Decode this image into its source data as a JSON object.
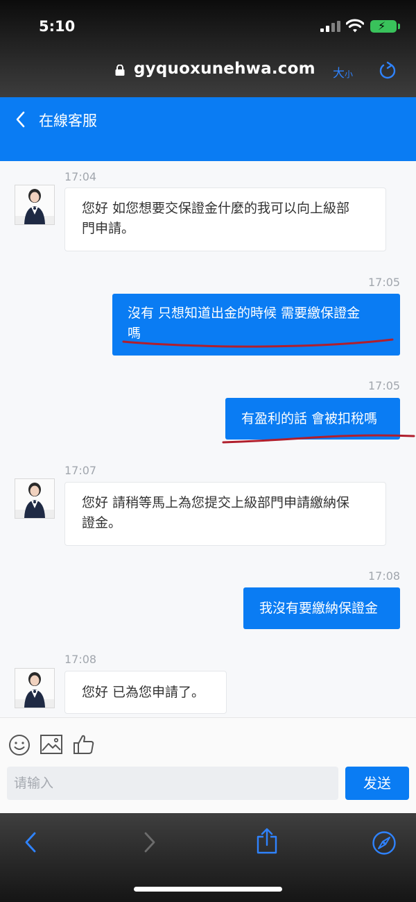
{
  "status_bar": {
    "time": "5:10"
  },
  "browser": {
    "url": "gyquoxunehwa.com",
    "textsize_big": "大",
    "textsize_small": "小"
  },
  "header": {
    "title": "在線客服"
  },
  "messages": [
    {
      "time": "17:04",
      "line1": "您好 如您想要交保證金什麼的我可以向上級部",
      "line2": "門申請。"
    },
    {
      "time": "17:05",
      "line1": "沒有 只想知道出金的時候 需要繳保證金",
      "line2": "嗎"
    },
    {
      "time": "17:05",
      "text": "有盈利的話 會被扣稅嗎"
    },
    {
      "time": "17:07",
      "line1": "您好 請稍等馬上為您提交上級部門申請繳納保",
      "line2": "證金。"
    },
    {
      "time": "17:08",
      "text": "我沒有要繳納保證金"
    },
    {
      "time": "17:08",
      "text": "您好 已為您申請了。"
    }
  ],
  "composer": {
    "placeholder": "请输入",
    "send_label": "发送"
  },
  "icons": {
    "toolbar": [
      "emoji-icon",
      "image-icon",
      "thumbs-up-icon"
    ],
    "browser_nav": [
      "back-icon",
      "forward-icon",
      "share-icon",
      "compass-icon"
    ]
  },
  "colors": {
    "accent": "#0a7cf3",
    "annotation": "#b01f2d"
  }
}
